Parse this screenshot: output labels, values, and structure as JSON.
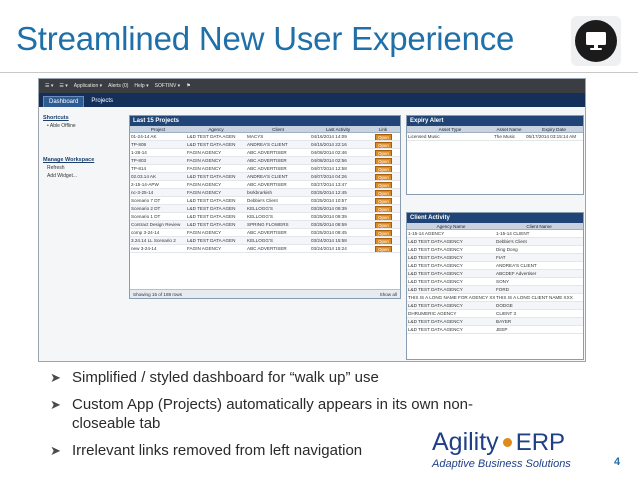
{
  "slide": {
    "title": "Streamlined New User Experience",
    "page_number": "4",
    "bullets": [
      "Simplified / styled dashboard for “walk up” use",
      "Custom App (Projects) automatically appears in its own non-closeable tab",
      "Irrelevant links removed from left navigation"
    ],
    "bullet_icon": "arrow-bullet-icon",
    "badge_icon": "monitor-icon",
    "logo": {
      "name": "Agility",
      "suffix": "ERP",
      "tagline": "Adaptive Business Solutions"
    },
    "title_color": "#1f6fa8"
  },
  "app": {
    "topbar": [
      "☰ ▾",
      "☰ ▾",
      "Application ▾",
      "Alerts (0)",
      "Help ▾",
      "SOFTINV ▾",
      "⚑"
    ],
    "tabs": [
      "Dashboard",
      "Projects"
    ],
    "sidebar": {
      "shortcuts_heading": "Shortcuts",
      "shortcut_item": "Able Offline",
      "workspace_heading": "Manage Workspace",
      "workspace_items": [
        "Refresh",
        "Add Widget..."
      ]
    },
    "projects_panel": {
      "title": "Last 15 Projects",
      "columns": [
        "Project",
        "Agency",
        "Client",
        "Last Activity",
        "Link"
      ],
      "rows": [
        [
          "01-24-14 AK",
          "L&D TEST DATA AGEN",
          "MACYS",
          "04/16/2014 14:09",
          "Open"
        ],
        [
          "TP-808",
          "L&D TEST DATA AGEN",
          "ANDREA'S CLIENT",
          "04/15/2014 22:16",
          "Open"
        ],
        [
          "1-28-14",
          "FAGIN AGENCY",
          "ABC ADVERTISER",
          "04/08/2014 02:46",
          "Open"
        ],
        [
          "TP-803",
          "FAGIN AGENCY",
          "ABC ADVERTISER",
          "04/08/2014 02:56",
          "Open"
        ],
        [
          "TP-814",
          "FAGIN AGENCY",
          "ABC ADVERTISER",
          "04/07/2014 12:58",
          "Open"
        ],
        [
          "02.03.14 AK",
          "L&D TEST DATA AGEN",
          "ANDREA'S CLIENT",
          "04/07/2014 04:26",
          "Open"
        ],
        [
          "2-15-14-APW",
          "FAGIN AGENCY",
          "ABC ADVERTISER",
          "03/27/2014 13:47",
          "Open"
        ],
        [
          "nc-3-25-14",
          "FAGIN AGENCY",
          "bsrkbrarkish",
          "03/25/2014 12:45",
          "Open"
        ],
        [
          "Scenario 7 DT",
          "L&D TEST DATA AGEN",
          "Debbie's Client",
          "03/25/2014 10:57",
          "Open"
        ],
        [
          "Scenario 2 DT",
          "L&D TEST DATA AGEN",
          "KELLOGG'S",
          "03/25/2014 09:39",
          "Open"
        ],
        [
          "Scenario 1 DT",
          "L&D TEST DATA AGEN",
          "KELLOGG'S",
          "03/25/2014 09:39",
          "Open"
        ],
        [
          "Contract Design Review",
          "L&D TEST DATA AGEN",
          "SPRING FLOWERS",
          "03/25/2014 08:59",
          "Open"
        ],
        [
          "comp 3-24-14",
          "FAGIN AGENCY",
          "ABC ADVERTISER",
          "03/25/2014 08:45",
          "Open"
        ],
        [
          "3.24.14 LL Scenario 2",
          "L&D TEST DATA AGEN",
          "KELLOGG'S",
          "03/24/2014 15:58",
          "Open"
        ],
        [
          "new 3-24-14",
          "FAGIN AGENCY",
          "ABC ADVERTISER",
          "03/24/2014 15:24",
          "Open"
        ]
      ],
      "footer_left": "Showing 15 of 188 rows",
      "footer_right": "Show all"
    },
    "expiry_panel": {
      "title": "Expiry Alert",
      "columns": [
        "Asset Type",
        "Asset Name",
        "Expiry Date"
      ],
      "rows": [
        [
          "Licensed Music",
          "The Music",
          "05/17/2014 03:15:14 AM"
        ]
      ]
    },
    "activity_panel": {
      "title": "Client Activity",
      "columns": [
        "Agency Name",
        "Client Name"
      ],
      "rows": [
        [
          "1-15-14 AGENCY",
          "1-15-14 CLIENT"
        ],
        [
          "L&D TEST DATA AGENCY",
          "Debbie's Client"
        ],
        [
          "L&D TEST DATA AGENCY",
          "Ding Dong"
        ],
        [
          "L&D TEST DATA AGENCY",
          "FIAT"
        ],
        [
          "L&D TEST DATA AGENCY",
          "ANDREA'S CLIENT"
        ],
        [
          "L&D TEST DATA AGENCY",
          "ABCDEF Advertiser"
        ],
        [
          "L&D TEST DATA AGENCY",
          "SONY"
        ],
        [
          "L&D TEST DATA AGENCY",
          "FORD"
        ],
        [
          "THIS IS A LONG NAME FOR AGENCY XXX",
          "THIS IS A LONG CLIENT NAME XXX"
        ],
        [
          "L&D TEST DATA AGENCY",
          "DODGE"
        ],
        [
          "DHRUMERIC AGENCY",
          "CLIENT 3"
        ],
        [
          "L&D TEST DATA AGENCY",
          "BAYER"
        ],
        [
          "L&D TEST DATA AGENCY",
          "JEEP"
        ]
      ]
    }
  }
}
